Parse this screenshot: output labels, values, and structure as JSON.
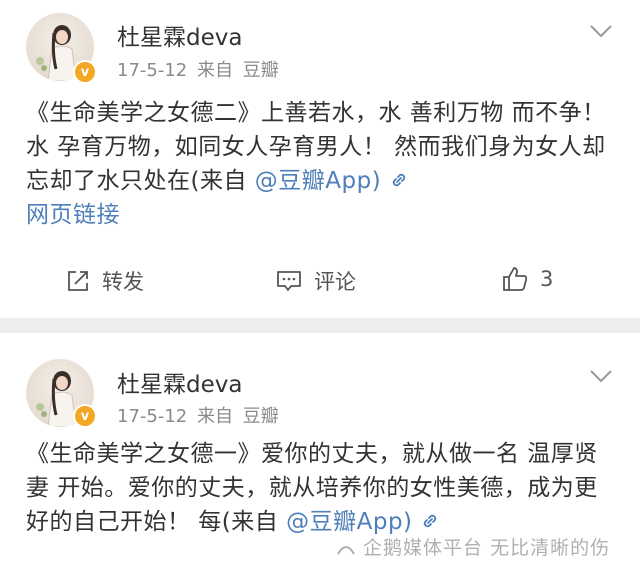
{
  "posts": [
    {
      "username": "杜星霖deva",
      "date": "17-5-12",
      "source": "来自 豆瓣",
      "content": "《生命美学之女德二》上善若水，水 善利万物 而不争！ 水 孕育万物，如同女人孕育男人！ 然而我们身为女人却忘却了水只处在(来自 ",
      "link_text": "@豆瓣App)",
      "tail_link": "网页链接",
      "actions": {
        "repost": "转发",
        "comment": "评论",
        "like_count": "3"
      },
      "verified_badge": "v"
    },
    {
      "username": "杜星霖deva",
      "date": "17-5-12",
      "source": "来自 豆瓣",
      "content": "《生命美学之女德一》爱你的丈夫，就从做一名 温厚贤妻 开始。爱你的丈夫，就从培养你的女性美德，成为更好的自己开始！ 每(来自 ",
      "link_text": "@豆瓣App)",
      "verified_badge": "v"
    }
  ],
  "watermark": "企鹅媒体平台 无比清晰的伤",
  "colors": {
    "link": "#4f7fba",
    "badge": "#f5a623",
    "meta": "#8a8a8a",
    "gap": "#eeeeee"
  },
  "icons": [
    "chevron-down-icon",
    "link-icon",
    "repost-icon",
    "comment-icon",
    "thumbs-up-icon",
    "verified-badge-icon",
    "watermark-logo-icon"
  ]
}
